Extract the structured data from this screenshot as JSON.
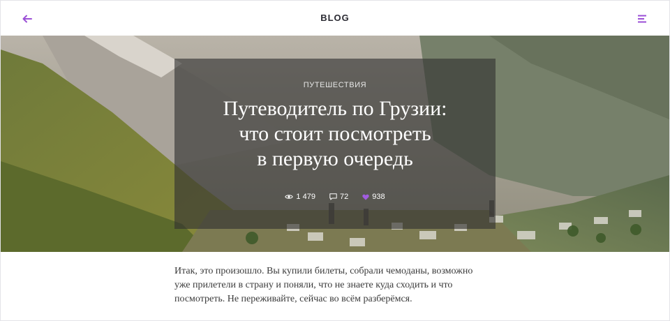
{
  "header": {
    "brand": "BLOG",
    "back_icon": "arrow-left-icon",
    "menu_icon": "hamburger-menu-icon"
  },
  "hero": {
    "category": "ПУТЕШЕСТВИЯ",
    "title_lines": [
      "Путеводитель по Грузии:",
      "что стоит посмотреть",
      "в первую очередь"
    ],
    "stats": {
      "views": "1 479",
      "comments": "72",
      "likes": "938"
    }
  },
  "article": {
    "lines": [
      "Итак, это произошло. Вы купили билеты, собрали чемоданы, возможно",
      "уже прилетели в страну и поняли, что не знаете куда сходить и что",
      "посмотреть. Не переживайте, сейчас во всём разберёмся."
    ]
  },
  "colors": {
    "accent": "#9b4fd6",
    "brand_text": "#2b2b33",
    "body_text": "#3a3a3a"
  }
}
